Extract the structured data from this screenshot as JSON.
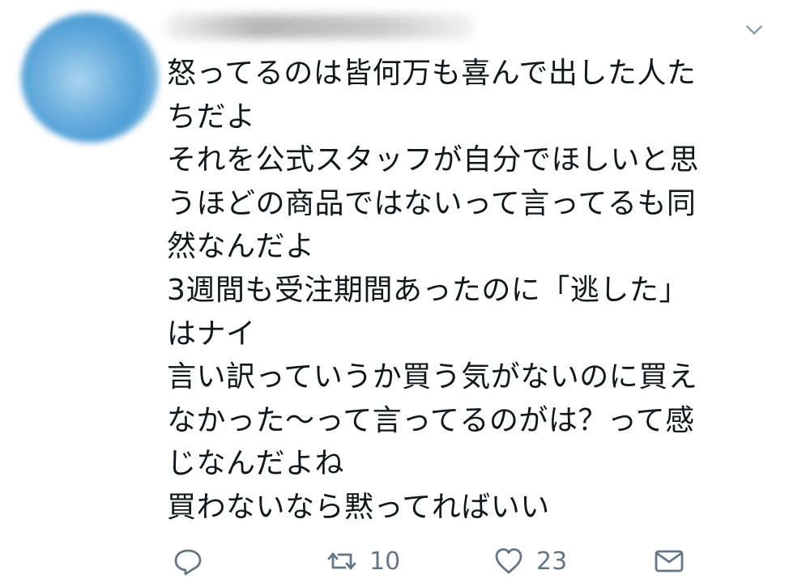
{
  "tweet": {
    "lines": [
      "怒ってるのは皆何万も喜んで出した人た",
      "ちだよ",
      "それを公式スタッフが自分でほしいと思",
      "うほどの商品ではないって言ってるも同",
      "然なんだよ",
      "3週間も受注期間あったのに「逃した」",
      "はナイ",
      "言い訳っていうか買う気がないのに買え",
      "なかった〜って言ってるのがは？って感",
      "じなんだよね",
      "買わないなら黙ってればいい"
    ],
    "actions": {
      "retweet_count": "10",
      "like_count": "23"
    },
    "icons": {
      "reply": "reply-icon",
      "retweet": "retweet-icon",
      "like": "heart-icon",
      "dm": "envelope-icon",
      "menu": "chevron-down-icon"
    },
    "colors": {
      "text": "#14171a",
      "icon": "#657786"
    }
  }
}
